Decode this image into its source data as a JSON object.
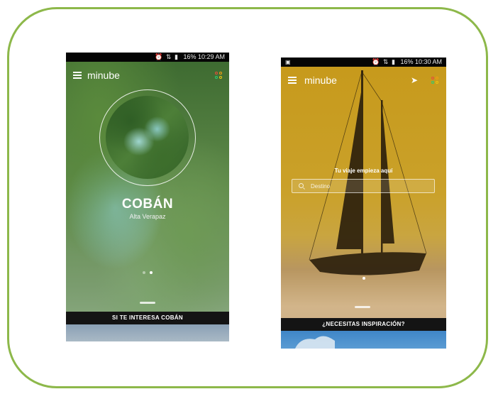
{
  "screen1": {
    "status": {
      "icons": "⏰ ⇅ ▮",
      "battery": "16%",
      "time": "10:29 AM"
    },
    "brand": "minube",
    "destination": {
      "city": "COBÁN",
      "region": "Alta Verapaz"
    },
    "cta_label": "SI TE INTERESA COBÁN"
  },
  "screen2": {
    "status": {
      "left_icon": "▣",
      "icons": "⏰ ⇅ ▮",
      "battery": "16%",
      "time": "10:30 AM"
    },
    "brand": "minube",
    "tagline": "Tu viaje empieza aquí",
    "search": {
      "placeholder": "Destino"
    },
    "cta_label": "¿NECESITAS INSPIRACIÓN?"
  },
  "colors": {
    "frame_border": "#8db84a",
    "cta_bar": "#141414",
    "status_bar": "#050505"
  },
  "icons": {
    "menu": "hamburger-icon",
    "brand_dots": "colored-dots-icon",
    "navigation": "navigation-arrow-icon",
    "search": "magnifier-icon"
  }
}
